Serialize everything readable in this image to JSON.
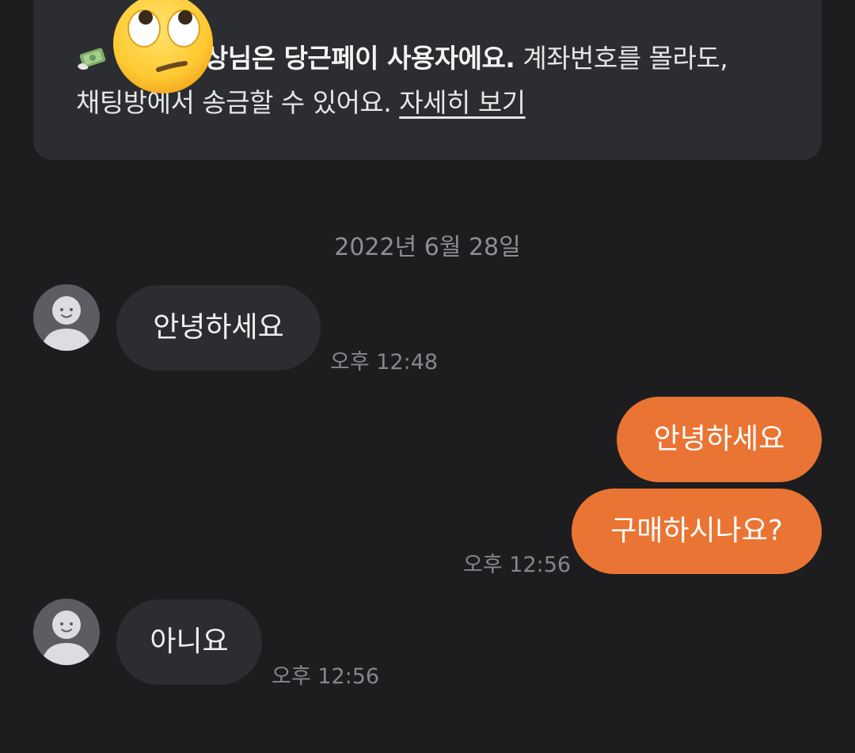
{
  "notice": {
    "name_suffix": "상님은 당근페이 사용자에요.",
    "rest_line1": " 계좌번호를 몰라도,",
    "line2": "채팅방에서 송금할 수 있어요. ",
    "link": "자세히 보기",
    "money_icon": "money-bag-icon",
    "overlay_icon": "face-with-rolling-eyes-emoji"
  },
  "date_divider": "2022년 6월 28일",
  "messages": [
    {
      "direction": "incoming",
      "text": "안녕하세요",
      "time": "오후 12:48"
    },
    {
      "direction": "outgoing",
      "text": "안녕하세요",
      "time": ""
    },
    {
      "direction": "outgoing",
      "text": "구매하시나요?",
      "time": "오후 12:56"
    },
    {
      "direction": "incoming",
      "text": "아니요",
      "time": "오후 12:56"
    }
  ],
  "colors": {
    "background": "#1d1d1f",
    "incoming_bubble": "#2b2d31",
    "outgoing_bubble": "#ea7433",
    "muted_text": "#85878c"
  }
}
